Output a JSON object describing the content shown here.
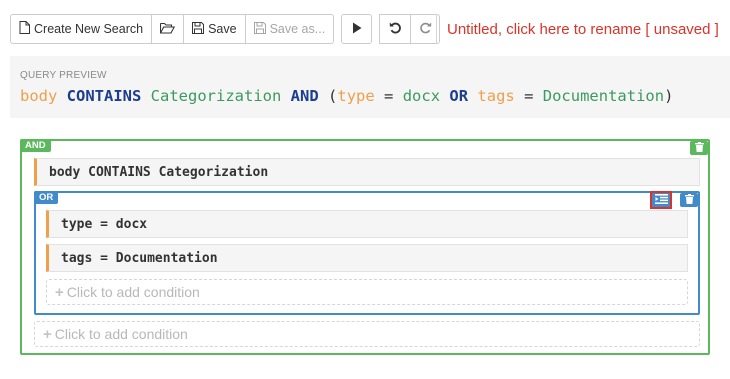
{
  "toolbar": {
    "create_label": "Create New Search",
    "save_label": "Save",
    "save_as_label": "Save as..."
  },
  "title_link": "Untitled, click here to rename [ unsaved ]",
  "preview": {
    "label": "QUERY PREVIEW",
    "tokens": {
      "body": "body",
      "contains": "CONTAINS",
      "categorization": "Categorization",
      "and": "AND",
      "open": "(",
      "type": "type",
      "eq1": "=",
      "docx": "docx",
      "or": "OR",
      "tags": "tags",
      "eq2": "=",
      "documentation": "Documentation",
      "close": ")"
    }
  },
  "builder": {
    "and_badge": "AND",
    "or_badge": "OR",
    "conditions": {
      "c1": "body CONTAINS Categorization",
      "c2": "type = docx",
      "c3": "tags = Documentation"
    },
    "add_condition": "Click to add condition"
  },
  "colors": {
    "and_group": "#5cb85c",
    "or_group": "#428bca",
    "field": "#f0a04b",
    "operator": "#1d3d8f",
    "value": "#3c9a5f",
    "warning": "#d9342b"
  }
}
